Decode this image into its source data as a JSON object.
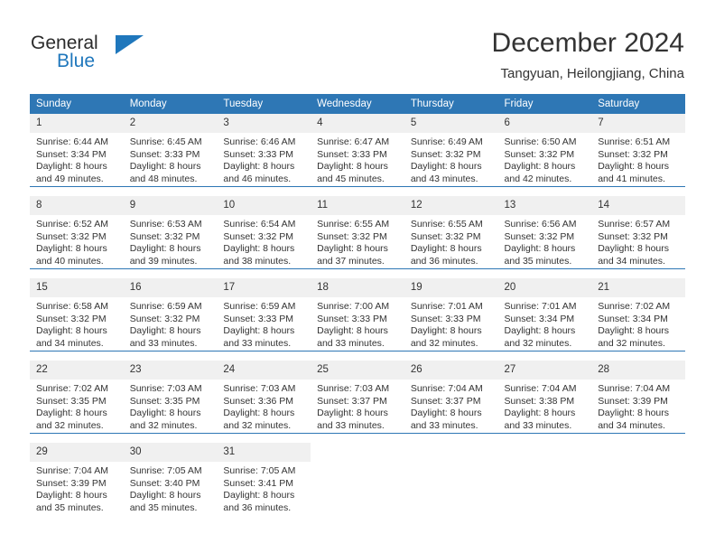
{
  "brand": {
    "name_top": "General",
    "name_bottom": "Blue",
    "accent_color": "#1f77bc",
    "flag_icon": "triangle-flag-icon"
  },
  "header": {
    "title": "December 2024",
    "location": "Tangyuan, Heilongjiang, China",
    "header_bg": "#2e77b5",
    "daynum_bg": "#f0f0f0"
  },
  "calendar": {
    "weekday_headers": [
      "Sunday",
      "Monday",
      "Tuesday",
      "Wednesday",
      "Thursday",
      "Friday",
      "Saturday"
    ],
    "weeks": [
      [
        {
          "day": "1",
          "sunrise": "Sunrise: 6:44 AM",
          "sunset": "Sunset: 3:34 PM",
          "daylight1": "Daylight: 8 hours",
          "daylight2": "and 49 minutes."
        },
        {
          "day": "2",
          "sunrise": "Sunrise: 6:45 AM",
          "sunset": "Sunset: 3:33 PM",
          "daylight1": "Daylight: 8 hours",
          "daylight2": "and 48 minutes."
        },
        {
          "day": "3",
          "sunrise": "Sunrise: 6:46 AM",
          "sunset": "Sunset: 3:33 PM",
          "daylight1": "Daylight: 8 hours",
          "daylight2": "and 46 minutes."
        },
        {
          "day": "4",
          "sunrise": "Sunrise: 6:47 AM",
          "sunset": "Sunset: 3:33 PM",
          "daylight1": "Daylight: 8 hours",
          "daylight2": "and 45 minutes."
        },
        {
          "day": "5",
          "sunrise": "Sunrise: 6:49 AM",
          "sunset": "Sunset: 3:32 PM",
          "daylight1": "Daylight: 8 hours",
          "daylight2": "and 43 minutes."
        },
        {
          "day": "6",
          "sunrise": "Sunrise: 6:50 AM",
          "sunset": "Sunset: 3:32 PM",
          "daylight1": "Daylight: 8 hours",
          "daylight2": "and 42 minutes."
        },
        {
          "day": "7",
          "sunrise": "Sunrise: 6:51 AM",
          "sunset": "Sunset: 3:32 PM",
          "daylight1": "Daylight: 8 hours",
          "daylight2": "and 41 minutes."
        }
      ],
      [
        {
          "day": "8",
          "sunrise": "Sunrise: 6:52 AM",
          "sunset": "Sunset: 3:32 PM",
          "daylight1": "Daylight: 8 hours",
          "daylight2": "and 40 minutes."
        },
        {
          "day": "9",
          "sunrise": "Sunrise: 6:53 AM",
          "sunset": "Sunset: 3:32 PM",
          "daylight1": "Daylight: 8 hours",
          "daylight2": "and 39 minutes."
        },
        {
          "day": "10",
          "sunrise": "Sunrise: 6:54 AM",
          "sunset": "Sunset: 3:32 PM",
          "daylight1": "Daylight: 8 hours",
          "daylight2": "and 38 minutes."
        },
        {
          "day": "11",
          "sunrise": "Sunrise: 6:55 AM",
          "sunset": "Sunset: 3:32 PM",
          "daylight1": "Daylight: 8 hours",
          "daylight2": "and 37 minutes."
        },
        {
          "day": "12",
          "sunrise": "Sunrise: 6:55 AM",
          "sunset": "Sunset: 3:32 PM",
          "daylight1": "Daylight: 8 hours",
          "daylight2": "and 36 minutes."
        },
        {
          "day": "13",
          "sunrise": "Sunrise: 6:56 AM",
          "sunset": "Sunset: 3:32 PM",
          "daylight1": "Daylight: 8 hours",
          "daylight2": "and 35 minutes."
        },
        {
          "day": "14",
          "sunrise": "Sunrise: 6:57 AM",
          "sunset": "Sunset: 3:32 PM",
          "daylight1": "Daylight: 8 hours",
          "daylight2": "and 34 minutes."
        }
      ],
      [
        {
          "day": "15",
          "sunrise": "Sunrise: 6:58 AM",
          "sunset": "Sunset: 3:32 PM",
          "daylight1": "Daylight: 8 hours",
          "daylight2": "and 34 minutes."
        },
        {
          "day": "16",
          "sunrise": "Sunrise: 6:59 AM",
          "sunset": "Sunset: 3:32 PM",
          "daylight1": "Daylight: 8 hours",
          "daylight2": "and 33 minutes."
        },
        {
          "day": "17",
          "sunrise": "Sunrise: 6:59 AM",
          "sunset": "Sunset: 3:33 PM",
          "daylight1": "Daylight: 8 hours",
          "daylight2": "and 33 minutes."
        },
        {
          "day": "18",
          "sunrise": "Sunrise: 7:00 AM",
          "sunset": "Sunset: 3:33 PM",
          "daylight1": "Daylight: 8 hours",
          "daylight2": "and 33 minutes."
        },
        {
          "day": "19",
          "sunrise": "Sunrise: 7:01 AM",
          "sunset": "Sunset: 3:33 PM",
          "daylight1": "Daylight: 8 hours",
          "daylight2": "and 32 minutes."
        },
        {
          "day": "20",
          "sunrise": "Sunrise: 7:01 AM",
          "sunset": "Sunset: 3:34 PM",
          "daylight1": "Daylight: 8 hours",
          "daylight2": "and 32 minutes."
        },
        {
          "day": "21",
          "sunrise": "Sunrise: 7:02 AM",
          "sunset": "Sunset: 3:34 PM",
          "daylight1": "Daylight: 8 hours",
          "daylight2": "and 32 minutes."
        }
      ],
      [
        {
          "day": "22",
          "sunrise": "Sunrise: 7:02 AM",
          "sunset": "Sunset: 3:35 PM",
          "daylight1": "Daylight: 8 hours",
          "daylight2": "and 32 minutes."
        },
        {
          "day": "23",
          "sunrise": "Sunrise: 7:03 AM",
          "sunset": "Sunset: 3:35 PM",
          "daylight1": "Daylight: 8 hours",
          "daylight2": "and 32 minutes."
        },
        {
          "day": "24",
          "sunrise": "Sunrise: 7:03 AM",
          "sunset": "Sunset: 3:36 PM",
          "daylight1": "Daylight: 8 hours",
          "daylight2": "and 32 minutes."
        },
        {
          "day": "25",
          "sunrise": "Sunrise: 7:03 AM",
          "sunset": "Sunset: 3:37 PM",
          "daylight1": "Daylight: 8 hours",
          "daylight2": "and 33 minutes."
        },
        {
          "day": "26",
          "sunrise": "Sunrise: 7:04 AM",
          "sunset": "Sunset: 3:37 PM",
          "daylight1": "Daylight: 8 hours",
          "daylight2": "and 33 minutes."
        },
        {
          "day": "27",
          "sunrise": "Sunrise: 7:04 AM",
          "sunset": "Sunset: 3:38 PM",
          "daylight1": "Daylight: 8 hours",
          "daylight2": "and 33 minutes."
        },
        {
          "day": "28",
          "sunrise": "Sunrise: 7:04 AM",
          "sunset": "Sunset: 3:39 PM",
          "daylight1": "Daylight: 8 hours",
          "daylight2": "and 34 minutes."
        }
      ],
      [
        {
          "day": "29",
          "sunrise": "Sunrise: 7:04 AM",
          "sunset": "Sunset: 3:39 PM",
          "daylight1": "Daylight: 8 hours",
          "daylight2": "and 35 minutes."
        },
        {
          "day": "30",
          "sunrise": "Sunrise: 7:05 AM",
          "sunset": "Sunset: 3:40 PM",
          "daylight1": "Daylight: 8 hours",
          "daylight2": "and 35 minutes."
        },
        {
          "day": "31",
          "sunrise": "Sunrise: 7:05 AM",
          "sunset": "Sunset: 3:41 PM",
          "daylight1": "Daylight: 8 hours",
          "daylight2": "and 36 minutes."
        },
        {
          "day": "",
          "sunrise": "",
          "sunset": "",
          "daylight1": "",
          "daylight2": ""
        },
        {
          "day": "",
          "sunrise": "",
          "sunset": "",
          "daylight1": "",
          "daylight2": ""
        },
        {
          "day": "",
          "sunrise": "",
          "sunset": "",
          "daylight1": "",
          "daylight2": ""
        },
        {
          "day": "",
          "sunrise": "",
          "sunset": "",
          "daylight1": "",
          "daylight2": ""
        }
      ]
    ]
  }
}
